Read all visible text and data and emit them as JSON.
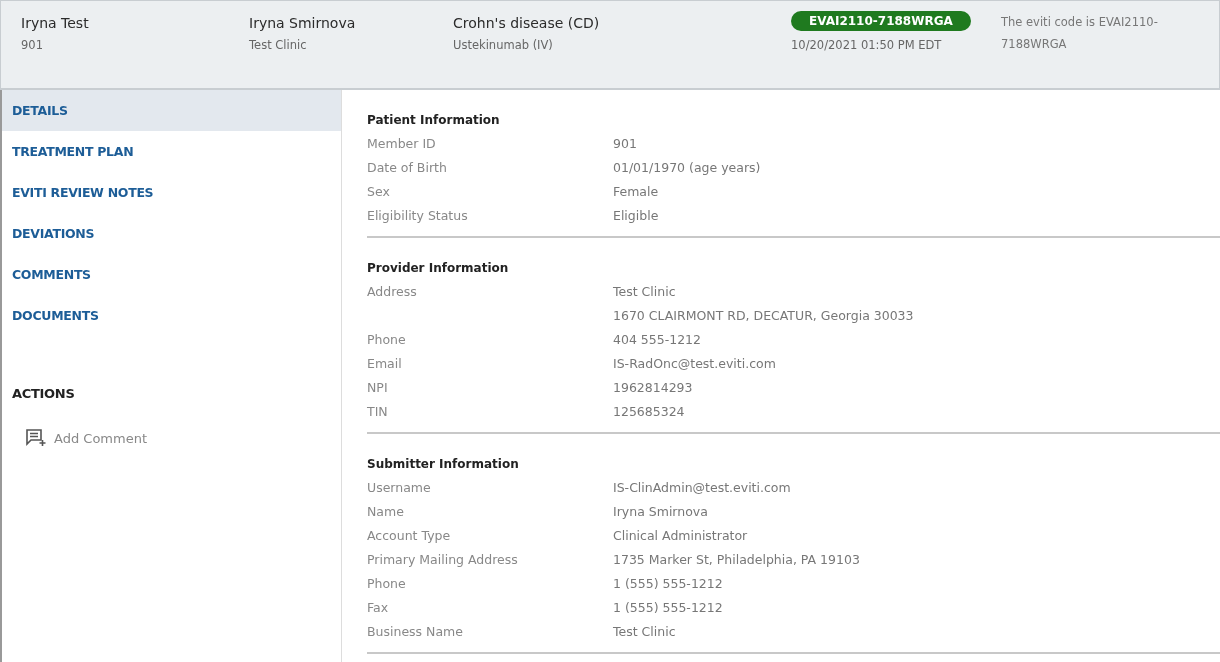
{
  "header": {
    "patient": {
      "name": "Iryna Test",
      "id": "901"
    },
    "provider": {
      "name": "Iryna Smirnova",
      "clinic": "Test Clinic"
    },
    "diagnosis": {
      "name": "Crohn's disease (CD)",
      "drug": "Ustekinumab (IV)"
    },
    "code_badge": "EVAI2110-7188WRGA",
    "timestamp": "10/20/2021 01:50 PM EDT",
    "code_note": "The eviti code is EVAI2110-7188WRGA"
  },
  "sidebar": {
    "items": [
      {
        "label": "DETAILS",
        "selected": true
      },
      {
        "label": "TREATMENT PLAN",
        "selected": false
      },
      {
        "label": "EVITI REVIEW NOTES",
        "selected": false
      },
      {
        "label": "DEVIATIONS",
        "selected": false
      },
      {
        "label": "COMMENTS",
        "selected": false
      },
      {
        "label": "DOCUMENTS",
        "selected": false
      }
    ],
    "actions_title": "ACTIONS",
    "actions": [
      {
        "label": "Add Comment"
      }
    ]
  },
  "sections": [
    {
      "title": "Patient Information",
      "rows": [
        {
          "label": "Member ID",
          "values": [
            "901"
          ]
        },
        {
          "label": "Date of Birth",
          "values": [
            "01/01/1970 (age years)"
          ]
        },
        {
          "label": "Sex",
          "values": [
            "Female"
          ]
        },
        {
          "label": "Eligibility Status",
          "values": [
            "Eligible"
          ]
        }
      ]
    },
    {
      "title": "Provider Information",
      "rows": [
        {
          "label": "Address",
          "values": [
            "Test Clinic",
            "1670 CLAIRMONT RD, DECATUR, Georgia 30033"
          ]
        },
        {
          "label": "Phone",
          "values": [
            "404 555-1212"
          ]
        },
        {
          "label": "Email",
          "values": [
            "IS-RadOnc@test.eviti.com"
          ]
        },
        {
          "label": "NPI",
          "values": [
            "1962814293"
          ]
        },
        {
          "label": "TIN",
          "values": [
            "125685324"
          ]
        }
      ]
    },
    {
      "title": "Submitter Information",
      "rows": [
        {
          "label": "Username",
          "values": [
            "IS-ClinAdmin@test.eviti.com"
          ]
        },
        {
          "label": "Name",
          "values": [
            "Iryna Smirnova"
          ]
        },
        {
          "label": "Account Type",
          "values": [
            "Clinical Administrator"
          ]
        },
        {
          "label": "Primary Mailing Address",
          "values": [
            "1735 Marker St, Philadelphia, PA 19103"
          ]
        },
        {
          "label": "Phone",
          "values": [
            "1 (555) 555-1212"
          ]
        },
        {
          "label": "Fax",
          "values": [
            "1 (555) 555-1212"
          ]
        },
        {
          "label": "Business Name",
          "values": [
            "Test Clinic"
          ]
        }
      ]
    }
  ]
}
